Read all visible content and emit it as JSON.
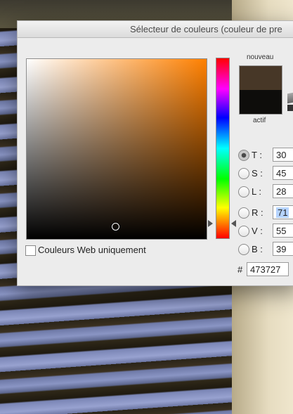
{
  "window": {
    "title": "Sélecteur de couleurs (couleur de pre"
  },
  "swatches": {
    "new_label": "nouveau",
    "current_label": "actif",
    "new_color": "#473727",
    "current_color": "#0e0d0b"
  },
  "fields": {
    "T": {
      "label": "T :",
      "value": "30"
    },
    "S": {
      "label": "S :",
      "value": "45"
    },
    "L": {
      "label": "L :",
      "value": "28"
    },
    "R": {
      "label": "R :",
      "value": "71"
    },
    "V": {
      "label": "V :",
      "value": "55"
    },
    "B": {
      "label": "B :",
      "value": "39"
    }
  },
  "hex": {
    "prefix": "#",
    "value": "473727"
  },
  "web_only": {
    "label": "Couleurs Web uniquement",
    "checked": false
  },
  "colors": {
    "hue_color": "#ff8000"
  }
}
